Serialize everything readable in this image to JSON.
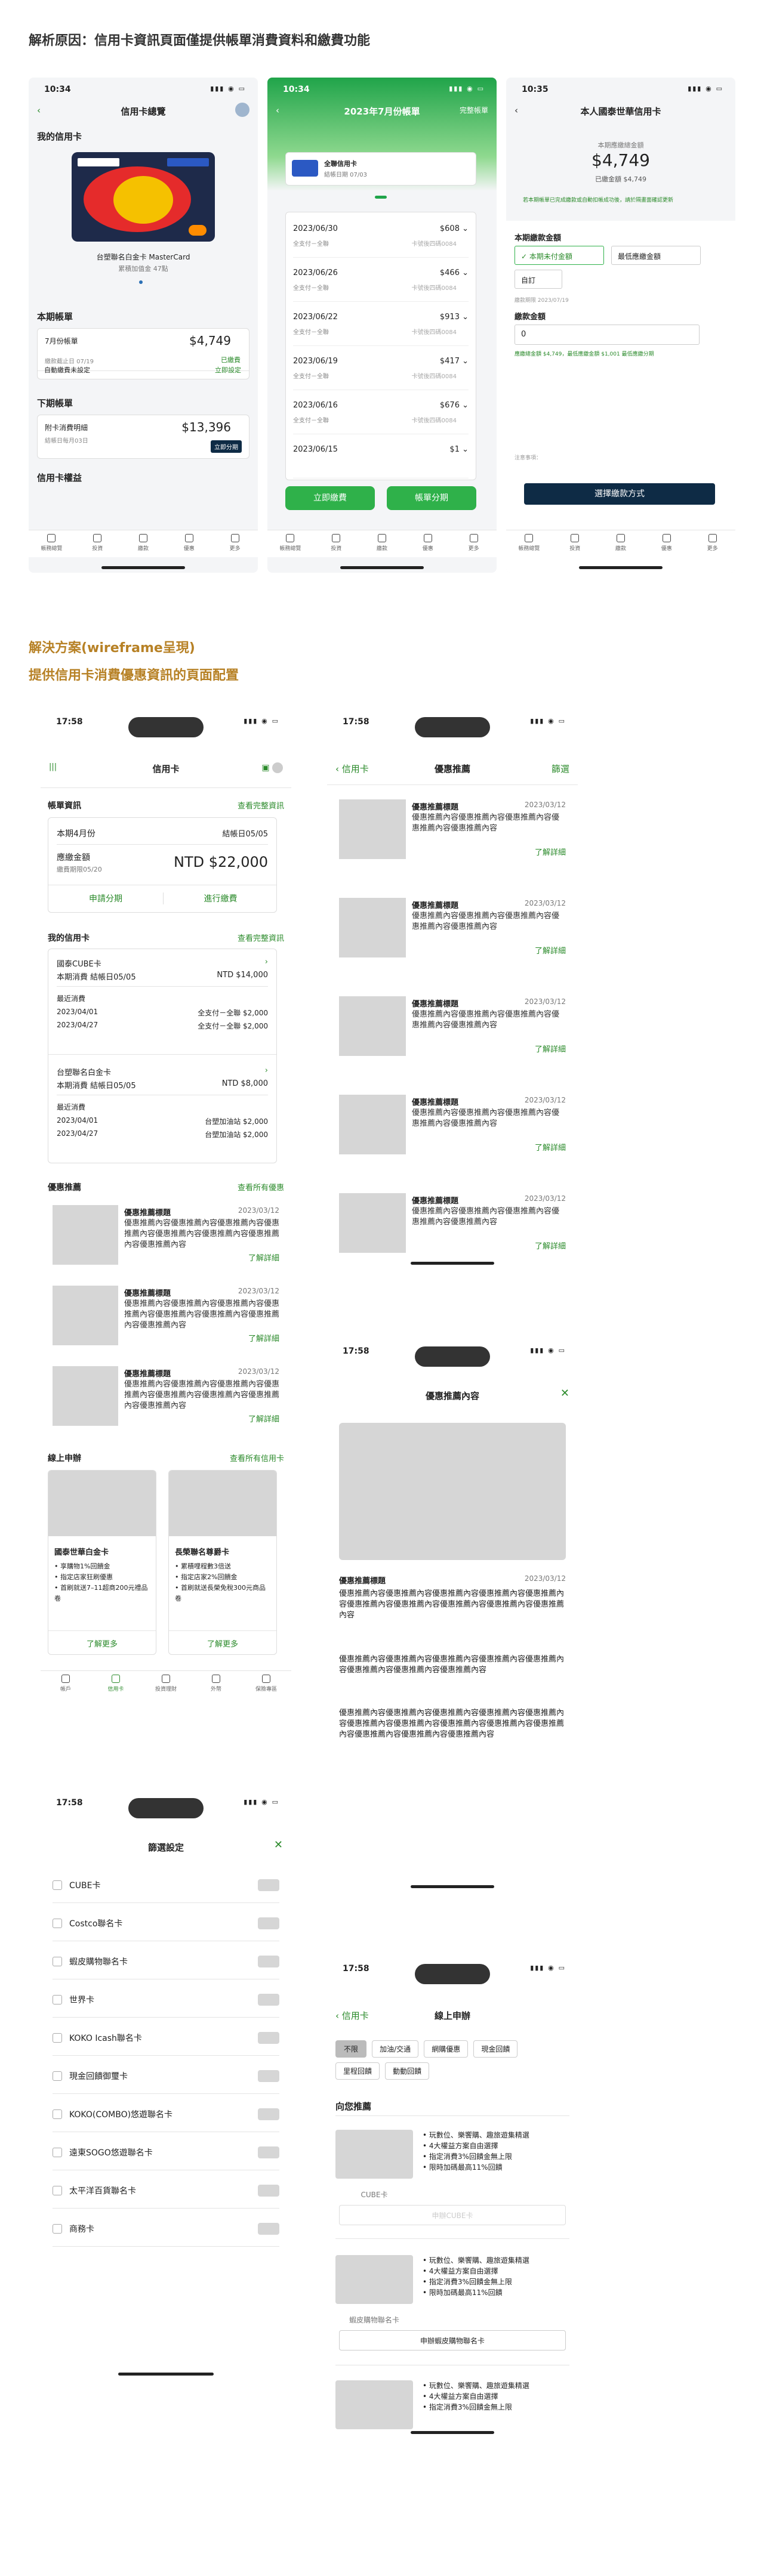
{
  "section1": {
    "title": "解析原因：信用卡資訊頁面僅提供帳單消費資料和繳費功能"
  },
  "s1": {
    "time": "10:34",
    "title": "信用卡總覽",
    "my_cards": "我的信用卡",
    "card_name": "台塑聯名白金卡 MasterCard",
    "card_points": "累積加值金 47點",
    "bill_heading": "本期帳單",
    "bill_label": "7月份帳單",
    "bill_amount": "$4,749",
    "bill_due": "繳款截止日 07/19",
    "bill_status": "已繳費",
    "auto_pay": "自動繳費未設定",
    "auto_pay_link": "立即設定",
    "next_bill": "下期帳單",
    "next_label": "附卡消費明細",
    "next_date": "結帳日每月03日",
    "next_amount": "$13,396",
    "next_btn": "立即分期",
    "cut_label": "信用卡權益",
    "tabs": [
      "帳務總覽",
      "投資",
      "繳款",
      "優惠",
      "更多"
    ]
  },
  "s2": {
    "time": "10:34",
    "title": "2023年7月份帳單",
    "right": "完整帳單",
    "card_name": "全聯信用卡",
    "card_sub": "結帳日期 07/03",
    "rows": [
      {
        "date": "2023/06/30",
        "amt": "$608",
        "l": "全支付－全聯",
        "r": "卡號後四碼0084"
      },
      {
        "date": "2023/06/26",
        "amt": "$466",
        "l": "全支付－全聯",
        "r": "卡號後四碼0084"
      },
      {
        "date": "2023/06/22",
        "amt": "$913",
        "l": "全支付－全聯",
        "r": "卡號後四碼0084"
      },
      {
        "date": "2023/06/19",
        "amt": "$417",
        "l": "全支付－全聯",
        "r": "卡號後四碼0084"
      },
      {
        "date": "2023/06/16",
        "amt": "$676",
        "l": "全支付－全聯",
        "r": "卡號後四碼0084"
      },
      {
        "date": "2023/06/15",
        "amt": "$1",
        "l": "",
        "r": ""
      }
    ],
    "btn1": "立即繳費",
    "btn2": "帳單分期",
    "tabs": [
      "帳務總覽",
      "投資",
      "繳款",
      "優惠",
      "更多"
    ]
  },
  "s3": {
    "time": "10:35",
    "title": "本人國泰世華信用卡",
    "due_label": "本期應繳總金額",
    "due_amount": "$4,749",
    "paid": "已繳金額 $4,749",
    "notice": "若本期帳單已完成繳款或自動扣帳成功後，請於隔畫面確認更新",
    "amount_label": "本期繳款金額",
    "opt1": "本期未付金額",
    "opt2": "最低應繳金額",
    "opt3": "自訂",
    "due_date": "繳款期限 2023/07/19",
    "pay_label": "繳款金額",
    "pay_value": "0",
    "pay_note": "應繳總金額 $4,749，最低應繳金額 $1,001",
    "pay_link": "最低應繳分期",
    "remark": "注意事項：",
    "btn": "選擇繳款方式",
    "tabs": [
      "帳務總覽",
      "投資",
      "繳款",
      "優惠",
      "更多"
    ]
  },
  "section2": {
    "title": "解決方案(wireframe呈現)",
    "subtitle": "提供信用卡消費優惠資訊的頁面配置"
  },
  "w1": {
    "time": "17:58",
    "title": "信用卡",
    "bill": "帳單資訊",
    "bill_link": "查看完整資訊",
    "month": "本期4月份",
    "month_right": "結帳日05/05",
    "due": "應繳金額",
    "due_sub": "繳費期限05/20",
    "amount": "NTD $22,000",
    "btn1": "申請分期",
    "btn2": "進行繳費",
    "my_cards": "我的信用卡",
    "my_cards_link": "查看完整資訊",
    "c1": {
      "name": "國泰CUBE卡",
      "sub": "本期消費 結帳日05/05",
      "amt": "NTD $14,000",
      "recent": "最近消費",
      "r1d": "2023/04/01",
      "r1": "全支付－全聯 $2,000",
      "r2d": "2023/04/27",
      "r2": "全支付－全聯 $2,000"
    },
    "c2": {
      "name": "台塑聯名白金卡",
      "sub": "本期消費 結帳日05/05",
      "amt": "NTD $8,000",
      "recent": "最近消費",
      "r1d": "2023/04/01",
      "r1": "台塑加油站 $2,000",
      "r2d": "2023/04/27",
      "r2": "台塑加油站 $2,000"
    },
    "promo": "優惠推薦",
    "promo_link": "查看所有優惠",
    "promo_title": "優惠推薦標題",
    "promo_date": "2023/03/12",
    "promo_text": "優惠推薦內容優惠推薦內容優惠推薦內容優惠推薦內容優惠推薦內容優惠推薦內容優惠推薦內容優惠推薦內容",
    "more": "了解詳細",
    "apply": "線上申辦",
    "apply_link": "查看所有信用卡",
    "ac1": {
      "name": "國泰世華白金卡",
      "b": [
        "享購物1%回饋金",
        "指定店家狂刷優惠",
        "首刷就送7–11超商200元禮品卷"
      ]
    },
    "ac2": {
      "name": "長榮聯名尊爵卡",
      "b": [
        "累積哩程數3倍送",
        "指定店家2%回饋金",
        "首刷就送長榮免稅300元商品卷"
      ]
    },
    "learn": "了解更多",
    "tabs": [
      "帳戶",
      "信用卡",
      "投資理財",
      "外幣",
      "保險專區"
    ]
  },
  "w2": {
    "time": "17:58",
    "back": "信用卡",
    "title": "優惠推薦",
    "right": "篩選",
    "item_title": "優惠推薦標題",
    "date": "2023/03/12",
    "text": "優惠推薦內容優惠推薦內容優惠推薦內容優惠推薦內容優惠推薦內容",
    "more": "了解詳細"
  },
  "w3": {
    "time": "17:58",
    "title": "優惠推薦內容",
    "item_title": "優惠推薦標題",
    "date": "2023/03/12",
    "p1": "優惠推薦內容優惠推薦內容優惠推薦內容優惠推薦內容優惠推薦內容優惠推薦內容優惠推薦內容優惠推薦內容優惠推薦內容優惠推薦內容",
    "p2": "優惠推薦內容優惠推薦內容優惠推薦內容優惠推薦內容優惠推薦內容優惠推薦內容優惠推薦內容優惠推薦內容",
    "p3": "優惠推薦內容優惠推薦內容優惠推薦內容優惠推薦內容優惠推薦內容優惠推薦內容優惠推薦內容優惠推薦內容優惠推薦內容優惠推薦內容優惠推薦內容優惠推薦內容優惠推薦內容"
  },
  "w4": {
    "time": "17:58",
    "title": "篩選設定",
    "items": [
      "CUBE卡",
      "Costco聯名卡",
      "蝦皮購物聯名卡",
      "世界卡",
      "KOKO Icash聯名卡",
      "現金回饋御璽卡",
      "KOKO(COMBO)悠遊聯名卡",
      "遠東SOGO悠遊聯名卡",
      "太平洋百貨聯名卡",
      "商務卡"
    ]
  },
  "w5": {
    "time": "17:58",
    "back": "信用卡",
    "title": "線上申辦",
    "chips": [
      "不限",
      "加油/交通",
      "網購優惠",
      "現金回饋",
      "里程回饋",
      "動動回饋"
    ],
    "rec": "向您推薦",
    "bullets": [
      "玩數位、樂饗購、趣旅遊集精選",
      "4大權益方案自由選擇",
      "指定消費3%回饋金無上限",
      "限時加碼最高11%回饋"
    ],
    "card1": "CUBE卡",
    "btn1": "申辦CUBE卡",
    "card2": "蝦皮購物聯名卡",
    "btn2": "申辦蝦皮購物聯名卡"
  }
}
